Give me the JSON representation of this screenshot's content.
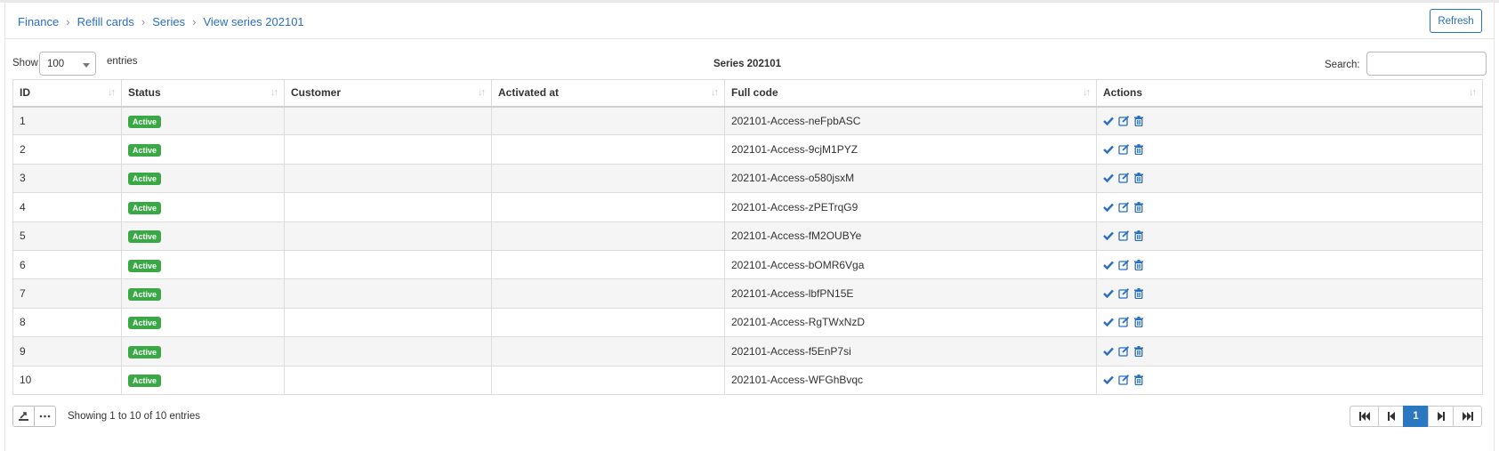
{
  "breadcrumb": [
    "Finance",
    "Refill cards",
    "Series",
    "View series 202101"
  ],
  "header": {
    "refresh_label": "Refresh"
  },
  "controls": {
    "show_label": "Show",
    "length_value": "100",
    "entries_label": "entries",
    "table_title": "Series 202101",
    "search_label": "Search:",
    "search_value": ""
  },
  "table": {
    "columns": [
      "ID",
      "Status",
      "Customer",
      "Activated at",
      "Full code",
      "Actions"
    ],
    "rows": [
      {
        "id": "1",
        "status": "Active",
        "customer": "",
        "activated_at": "",
        "full_code": "202101-Access-neFpbASC"
      },
      {
        "id": "2",
        "status": "Active",
        "customer": "",
        "activated_at": "",
        "full_code": "202101-Access-9cjM1PYZ"
      },
      {
        "id": "3",
        "status": "Active",
        "customer": "",
        "activated_at": "",
        "full_code": "202101-Access-o580jsxM"
      },
      {
        "id": "4",
        "status": "Active",
        "customer": "",
        "activated_at": "",
        "full_code": "202101-Access-zPETrqG9"
      },
      {
        "id": "5",
        "status": "Active",
        "customer": "",
        "activated_at": "",
        "full_code": "202101-Access-fM2OUBYe"
      },
      {
        "id": "6",
        "status": "Active",
        "customer": "",
        "activated_at": "",
        "full_code": "202101-Access-bOMR6Vga"
      },
      {
        "id": "7",
        "status": "Active",
        "customer": "",
        "activated_at": "",
        "full_code": "202101-Access-lbfPN15E"
      },
      {
        "id": "8",
        "status": "Active",
        "customer": "",
        "activated_at": "",
        "full_code": "202101-Access-RgTWxNzD"
      },
      {
        "id": "9",
        "status": "Active",
        "customer": "",
        "activated_at": "",
        "full_code": "202101-Access-f5EnP7si"
      },
      {
        "id": "10",
        "status": "Active",
        "customer": "",
        "activated_at": "",
        "full_code": "202101-Access-WFGhBvqc"
      }
    ],
    "row_actions": [
      "check-icon",
      "edit-icon",
      "trash-icon"
    ]
  },
  "footer": {
    "info": "Showing 1 to 10 of 10 entries",
    "current_page": "1"
  },
  "colors": {
    "link": "#2a6fbf",
    "badge_active": "#39a845",
    "page_active": "#2a78c2"
  }
}
